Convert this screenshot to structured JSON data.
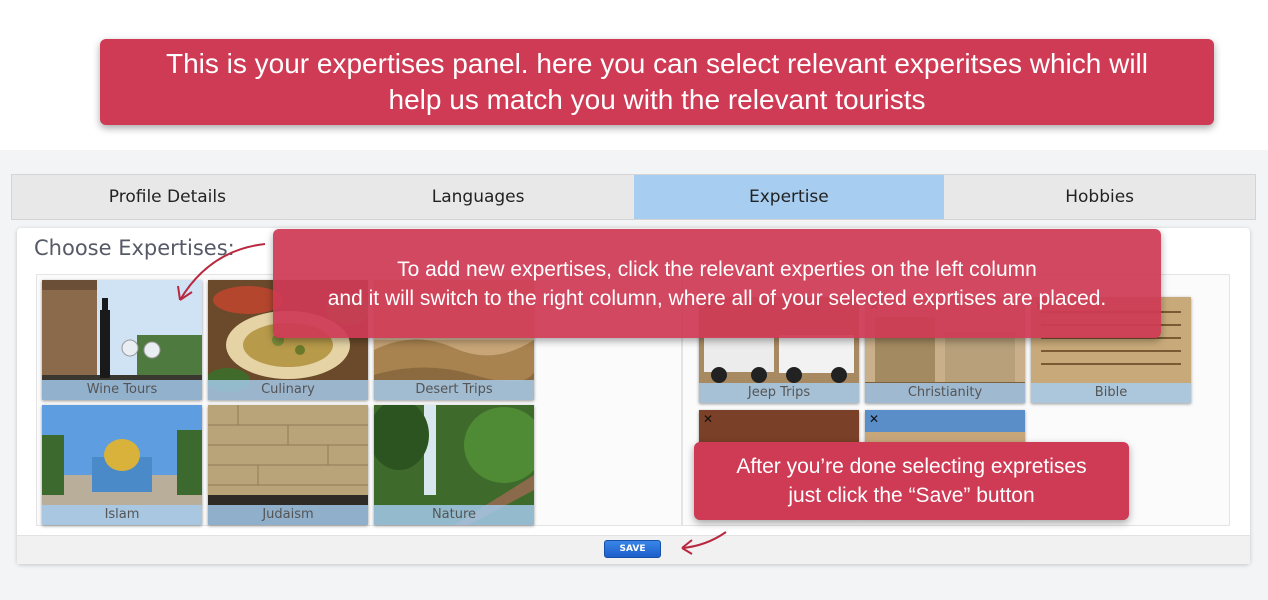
{
  "callouts": {
    "top_line1": "This is your expertises panel. here you can select relevant experitses which will",
    "top_line2": "help us match you with the relevant tourists",
    "mid_line1": "To add new expertises, click the relevant experties on the left column",
    "mid_line2": "and it will switch to the right column, where all of your selected exprtises are placed.",
    "bottom_line1": "After you’re done selecting expretises",
    "bottom_line2": "just click the “Save” button"
  },
  "tabs": [
    {
      "label": "Profile Details",
      "active": false
    },
    {
      "label": "Languages",
      "active": false
    },
    {
      "label": "Expertise",
      "active": true
    },
    {
      "label": "Hobbies",
      "active": false
    }
  ],
  "panel": {
    "title": "Choose Expertises:",
    "save_label": "SAVE"
  },
  "available": [
    {
      "label": "Wine Tours"
    },
    {
      "label": "Culinary"
    },
    {
      "label": "Desert Trips"
    },
    {
      "label": "Islam"
    },
    {
      "label": "Judaism"
    },
    {
      "label": "Nature"
    }
  ],
  "selected": [
    {
      "label": "Jeep Trips"
    },
    {
      "label": "Christianity"
    },
    {
      "label": "Bible"
    },
    {
      "label": ""
    },
    {
      "label": ""
    }
  ],
  "colors": {
    "callout": "#cf3a55",
    "active_tab": "#a7cdf1",
    "save_button": "#1b5fc9"
  }
}
